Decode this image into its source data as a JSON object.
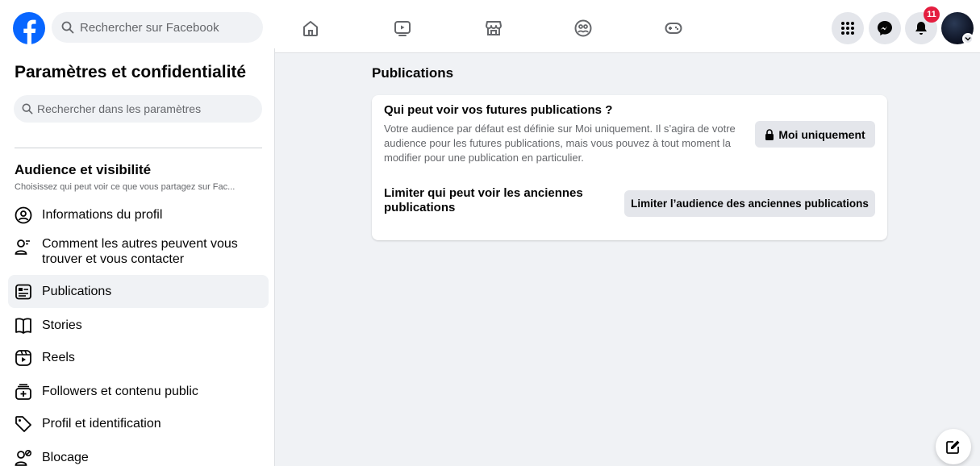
{
  "header": {
    "search_placeholder": "Rechercher sur Facebook",
    "notification_count": "11",
    "brand_color": "#0866ff",
    "nav_icons": [
      "home-icon",
      "video-icon",
      "marketplace-icon",
      "groups-icon",
      "gaming-icon"
    ]
  },
  "sidebar": {
    "title": "Paramètres et confidentialité",
    "search_placeholder": "Rechercher dans les paramètres",
    "section_title": "Audience et visibilité",
    "section_subtitle": "Choisissez qui peut voir ce que vous partagez sur Fac...",
    "items": [
      {
        "label": "Informations du profil",
        "icon": "profile-info-icon"
      },
      {
        "label": "Comment les autres peuvent vous trouver et vous contacter",
        "icon": "find-contact-icon"
      },
      {
        "label": "Publications",
        "icon": "posts-icon",
        "active": true
      },
      {
        "label": "Stories",
        "icon": "stories-icon"
      },
      {
        "label": "Reels",
        "icon": "reels-icon"
      },
      {
        "label": "Followers et contenu public",
        "icon": "followers-icon"
      },
      {
        "label": "Profil et identification",
        "icon": "tag-icon"
      },
      {
        "label": "Blocage",
        "icon": "blocking-icon"
      }
    ]
  },
  "main": {
    "title": "Publications",
    "future_posts": {
      "title": "Qui peut voir vos futures publications ?",
      "description": "Votre audience par défaut est définie sur Moi uniquement. Il s’agira de votre audience pour les futures publications, mais vous pouvez à tout moment la modifier pour une publication en particulier.",
      "button_label": "Moi uniquement"
    },
    "past_posts": {
      "title": "Limiter qui peut voir les anciennes publications",
      "button_label": "Limiter l’audience des anciennes publications"
    }
  }
}
